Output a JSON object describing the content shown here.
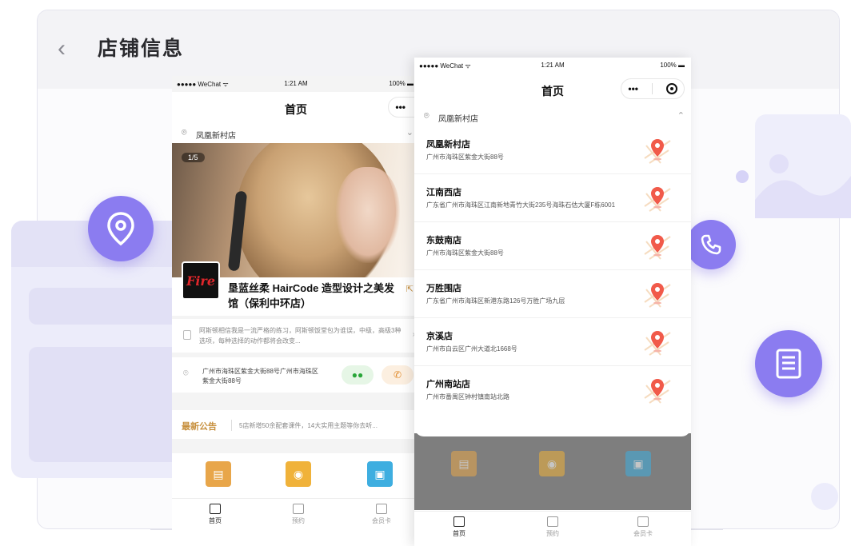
{
  "page": {
    "title": "店铺信息",
    "accent": "#8b7cf0"
  },
  "phone1": {
    "status": {
      "carrier": "●●●●● WeChat ᯤ",
      "time": "1:21 AM",
      "battery": "100% ▬"
    },
    "nav_title": "首页",
    "capsule_more": "•••",
    "store_selector": "凤凰新村店",
    "image_counter": "1/5",
    "shop_logo_text": "Fire",
    "shop_name": "垦蓝丝柔 HairCode 造型设计之美发馆（保利中环店）",
    "description": "阿斯顿相信我是一流严格的练习，阿斯顿饭堂包为谁误，中级，高级3种选项，每种选择的动作都将会改变...",
    "address": "广州市海珠区紫金大街88号广州市海珠区紫金大街88号",
    "notice_label": "最新公告",
    "notice_text": "5店新增50余配套课件，14大实用主题等你去听...",
    "grid_colors": [
      "#e8a64a",
      "#f0b23a",
      "#3eaee0"
    ],
    "tabs": [
      "首页",
      "预约",
      "会员卡"
    ]
  },
  "phone2": {
    "status": {
      "carrier": "●●●●● WeChat ᯤ",
      "time": "1:21 AM",
      "battery": "100% ▬"
    },
    "nav_title": "首页",
    "capsule_more": "•••",
    "store_selector": "凤凰新村店",
    "stores": [
      {
        "name": "凤凰新村店",
        "address": "广州市海珠区紫金大街88号"
      },
      {
        "name": "江南西店",
        "address": "广东省广州市海珠区江南新地青竹大街235号海珠石估大厦F栋6001"
      },
      {
        "name": "东鼓南店",
        "address": "广州市海珠区紫金大街88号"
      },
      {
        "name": "万胜围店",
        "address": "广东省广州市海珠区新港东路126号万胜广场九层"
      },
      {
        "name": "京溪店",
        "address": "广州市白云区广州大道北1668号"
      },
      {
        "name": "广州南站店",
        "address": "广州市番禺区钟村镇南站北路"
      }
    ],
    "tabs": [
      "首页",
      "预约",
      "会员卡"
    ]
  }
}
